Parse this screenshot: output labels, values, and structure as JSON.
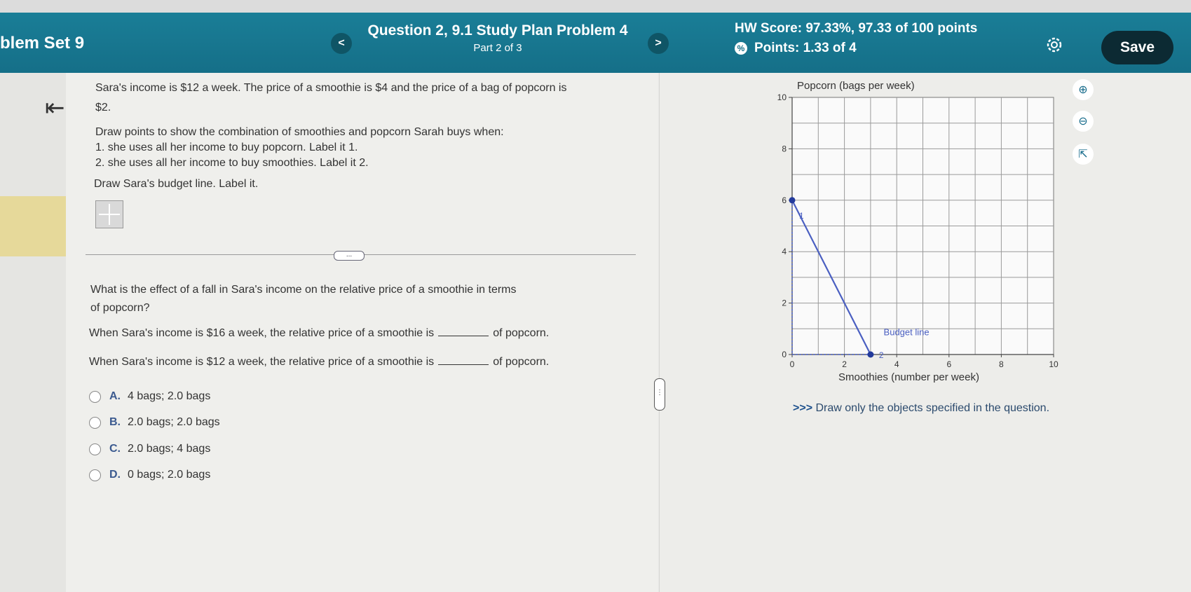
{
  "header": {
    "set_title": "blem Set 9",
    "question_title": "Question 2, 9.1 Study Plan Problem 4",
    "part": "Part 2 of 3",
    "hw_score": "HW Score: 97.33%, 97.33 of 100 points",
    "points": "Points: 1.33 of 4",
    "prev_label": "<",
    "next_label": ">",
    "save_label": "Save"
  },
  "question": {
    "intro_line1": "Sara's income is $12 a week. The price of a smoothie is $4 and the price of a bag of popcorn is",
    "intro_line2": "$2.",
    "draw_line": "Draw points to show the combination of smoothies  and popcorn Sarah buys when:",
    "item1": "1. she uses all her income to buy popcorn. Label it 1.",
    "item2": "2. she uses all her income to buy smoothies. Label it 2.",
    "budget_line": "Draw Sara's budget line. Label it.",
    "more": "...",
    "effect_q1": "What is the effect of a fall in Sara's income on the relative price of a smoothie in terms",
    "effect_q2": "of popcorn?",
    "s1_pre": "When Sara's income is $16 a week, the relative price of a smoothie is",
    "s1_post": "of popcorn.",
    "s2_pre": "When Sara's income is $12 a week, the relative price of a smoothie is",
    "s2_post": "of popcorn."
  },
  "options": [
    {
      "letter": "A.",
      "text": "4 bags; 2.0 bags"
    },
    {
      "letter": "B.",
      "text": "2.0 bags; 2.0 bags"
    },
    {
      "letter": "C.",
      "text": "2.0 bags; 4 bags"
    },
    {
      "letter": "D.",
      "text": "0 bags; 2.0 bags"
    }
  ],
  "graph": {
    "instruction_arrows": ">>>",
    "instruction_text": "Draw only the objects specified in the question."
  },
  "chart_data": {
    "type": "line",
    "ylabel": "Popcorn (bags per week)",
    "xlabel": "Smoothies (number per week)",
    "xlim": [
      0,
      10
    ],
    "ylim": [
      0,
      10
    ],
    "grid": true,
    "x_ticks": [
      0,
      2,
      4,
      6,
      8,
      10
    ],
    "y_ticks": [
      0,
      2,
      4,
      6,
      8,
      10
    ],
    "series": [
      {
        "name": "Budget line",
        "points": [
          [
            0,
            6
          ],
          [
            3,
            0
          ]
        ]
      }
    ],
    "point_labels": [
      {
        "label": "1",
        "x": 0,
        "y": 6
      },
      {
        "label": "2",
        "x": 3,
        "y": 0
      }
    ],
    "color": "#4a5fc1"
  }
}
